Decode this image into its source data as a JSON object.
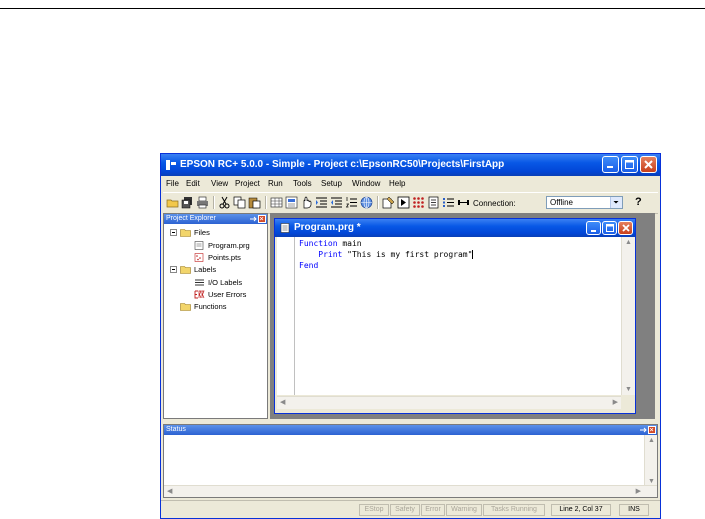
{
  "window": {
    "title": "EPSON RC+ 5.0.0 - Simple - Project c:\\EpsonRC50\\Projects\\FirstApp"
  },
  "menu": [
    "File",
    "Edit",
    "View",
    "Project",
    "Run",
    "Tools",
    "Setup",
    "Window",
    "Help"
  ],
  "toolbar": {
    "connection_label": "Connection:",
    "connection_value": "Offline",
    "help_label": "?"
  },
  "project_explorer": {
    "title": "Project Explorer",
    "tree": {
      "files": "Files",
      "program": "Program.prg",
      "points": "Points.pts",
      "labels": "Labels",
      "io_labels": "I/O Labels",
      "user_errors": "User Errors",
      "functions": "Functions"
    }
  },
  "document": {
    "title": "Program.prg *",
    "code": {
      "line1_kw": "Function",
      "line1_rest": " main",
      "line2_kw": "Print",
      "line2_str": " \"This is my first program\"",
      "line3_kw": "Fend"
    }
  },
  "status_pane": {
    "title": "Status"
  },
  "statusbar": {
    "estop": "EStop",
    "safety": "Safety",
    "error": "Error",
    "warning": "Warning",
    "tasks": "Tasks Running",
    "position": "Line 2, Col 37",
    "mode": "INS"
  },
  "colors": {
    "titlebar": "#0858e6",
    "keyword": "#0000ff",
    "mdi_background": "#808080"
  }
}
